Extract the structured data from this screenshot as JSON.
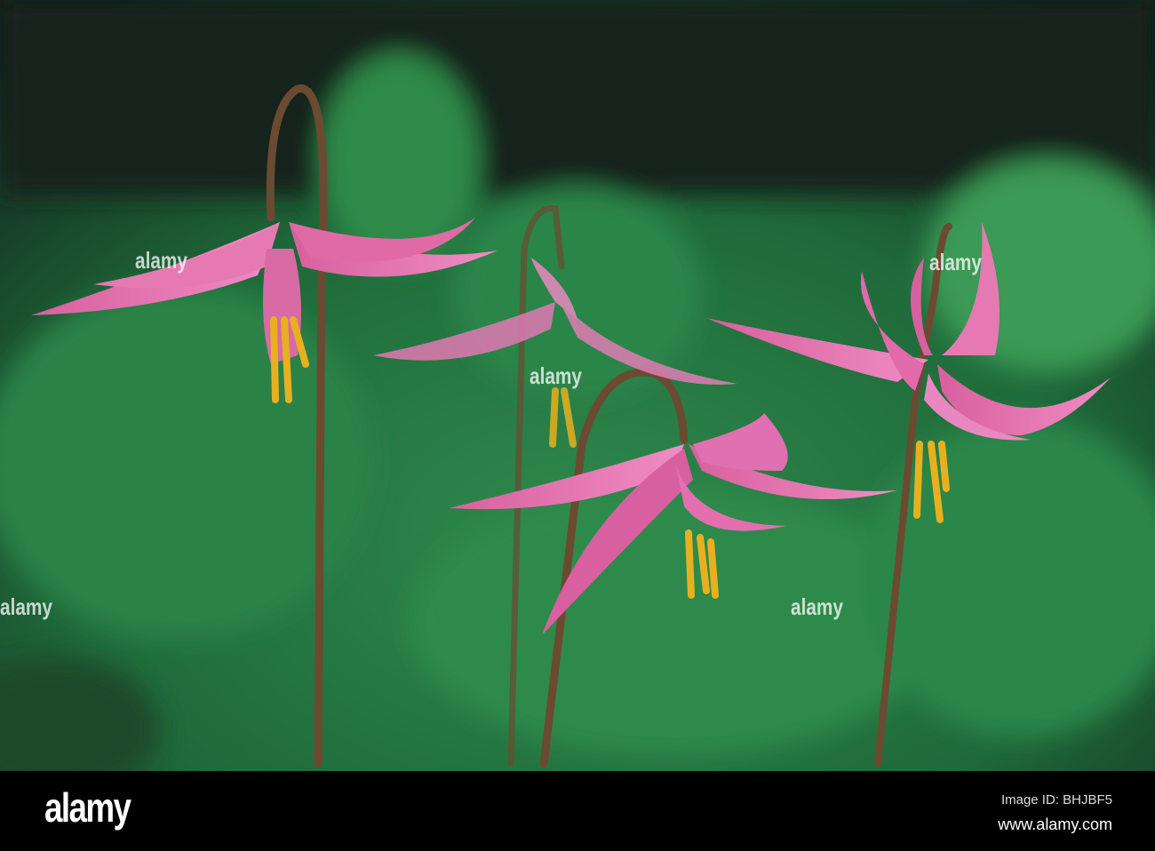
{
  "photo": {
    "subject": "pink fawn lilies",
    "colors": {
      "petal": "#e06aaa",
      "stamen": "#e8b020",
      "stem": "#6b4a32",
      "foliage": "#2f8a48",
      "background_dark": "#14241a"
    }
  },
  "watermark": {
    "text": "alamy"
  },
  "footer": {
    "logo": "alamy",
    "image_id": "Image ID: BHJBF5",
    "site": "www.alamy.com"
  }
}
